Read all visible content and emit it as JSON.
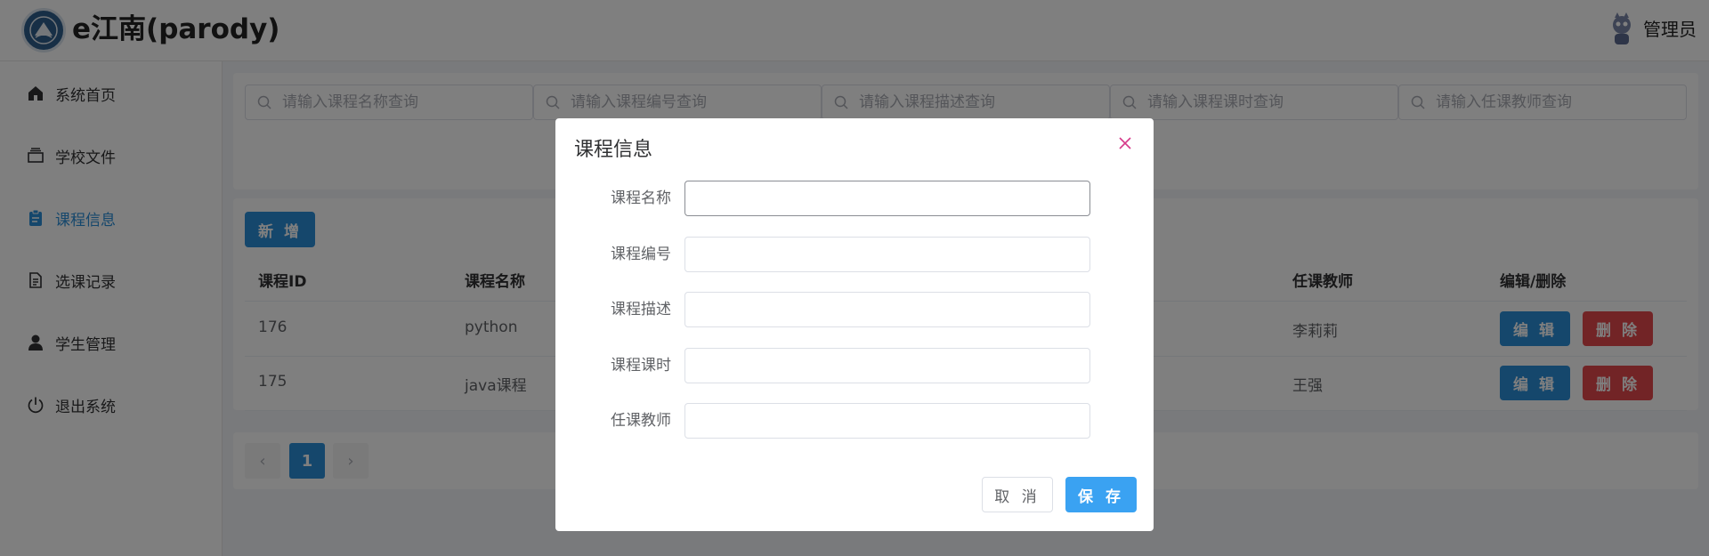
{
  "app": {
    "title": "e江南(parody)"
  },
  "header": {
    "username": "管理员"
  },
  "sidebar": {
    "items": [
      {
        "label": "系统首页",
        "icon": "home-icon"
      },
      {
        "label": "学校文件",
        "icon": "folder-stack-icon"
      },
      {
        "label": "课程信息",
        "icon": "clipboard-icon",
        "active": true
      },
      {
        "label": "选课记录",
        "icon": "document-icon"
      },
      {
        "label": "学生管理",
        "icon": "user-icon"
      },
      {
        "label": "退出系统",
        "icon": "power-icon"
      }
    ]
  },
  "search": {
    "placeholders": [
      "请输入课程名称查询",
      "请输入课程编号查询",
      "请输入课程描述查询",
      "请输入课程课时查询",
      "请输入任课教师查询"
    ]
  },
  "toolbar": {
    "add_label": "新 增"
  },
  "table": {
    "headers": [
      "课程ID",
      "课程名称",
      "任课教师",
      "编辑/删除"
    ],
    "rows": [
      {
        "id": "176",
        "name": "python",
        "teacher": "李莉莉"
      },
      {
        "id": "175",
        "name": "java课程",
        "teacher": "王强"
      }
    ],
    "edit_label": "编 辑",
    "delete_label": "删 除"
  },
  "pagination": {
    "prev": "‹",
    "current": "1",
    "next": "›"
  },
  "dialog": {
    "title": "课程信息",
    "fields": [
      {
        "label": "课程名称",
        "value": ""
      },
      {
        "label": "课程编号",
        "value": ""
      },
      {
        "label": "课程描述",
        "value": ""
      },
      {
        "label": "课程课时",
        "value": ""
      },
      {
        "label": "任课教师",
        "value": ""
      }
    ],
    "cancel_label": "取 消",
    "save_label": "保 存"
  },
  "colors": {
    "accent": "#2b8ed8",
    "danger": "#e5484d",
    "save": "#3aa2f2",
    "close": "#d63a8a"
  }
}
